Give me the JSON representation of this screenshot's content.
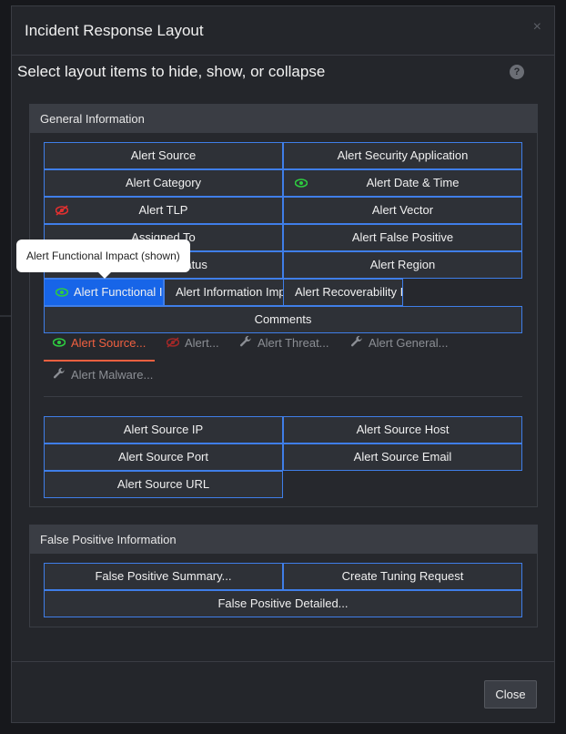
{
  "modal": {
    "title": "Incident Response Layout",
    "close_glyph": "×",
    "subtitle": "Select layout items to hide, show, or collapse",
    "help_glyph": "?"
  },
  "general": {
    "header": "General Information",
    "cells": {
      "alert_source": "Alert Source",
      "alert_security_application": "Alert Security Application",
      "alert_category": "Alert Category",
      "alert_date_time": "Alert Date & Time",
      "alert_tlp": "Alert TLP",
      "alert_vector": "Alert Vector",
      "assigned_to": "Assigned To",
      "alert_false_positive": "Alert False Positive",
      "status": "Status",
      "alert_region": "Alert Region",
      "alert_functional_impact": "Alert Functional Impact",
      "alert_information_impact": "Alert Information Impact",
      "alert_recoverability_impact": "Alert Recoverability Impact",
      "comments": "Comments"
    },
    "tooltip": "Alert Functional Impact (shown)",
    "tabs": {
      "alert_source": "Alert Source...",
      "alert": "Alert...",
      "alert_threat": "Alert Threat...",
      "alert_general": "Alert General...",
      "alert_malware": "Alert Malware..."
    },
    "source_cells": {
      "source_ip": "Alert Source IP",
      "source_host": "Alert Source Host",
      "source_port": "Alert Source Port",
      "source_email": "Alert Source Email",
      "source_url": "Alert Source URL"
    }
  },
  "false_positive": {
    "header": "False Positive Information",
    "summary": "False Positive Summary...",
    "tuning": "Create Tuning Request",
    "detailed": "False Positive Detailed..."
  },
  "footer": {
    "close_label": "Close"
  },
  "colors": {
    "accent_blue": "#3f7ee8",
    "selected_blue": "#1765e8",
    "eye_green": "#2ecc40",
    "eye_red": "#e03030",
    "active_tab": "#f06040"
  }
}
